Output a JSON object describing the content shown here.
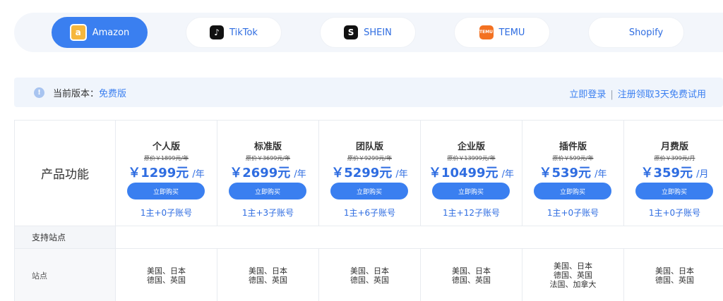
{
  "platforms": [
    {
      "label": "Amazon",
      "icon": "amazon-icon",
      "glyph": "a",
      "active": true
    },
    {
      "label": "TikTok",
      "icon": "tiktok-icon",
      "glyph": "♪",
      "active": false
    },
    {
      "label": "SHEIN",
      "icon": "shein-icon",
      "glyph": "S",
      "active": false
    },
    {
      "label": "TEMU",
      "icon": "temu-icon",
      "glyph": "TEMU",
      "active": false
    },
    {
      "label": "Shopify",
      "icon": "shopify-icon",
      "glyph": "🛍",
      "active": false
    }
  ],
  "version": {
    "label": "当前版本：",
    "value": "免费版",
    "login_link": "立即登录",
    "separator": "|",
    "trial_link": "注册领取3天免费试用"
  },
  "table": {
    "feature_header": "产品功能",
    "plans": [
      {
        "name": "个人版",
        "original": "原价￥1899元/年",
        "price": "￥1299元",
        "unit": "/年",
        "button": "立即购买",
        "accounts": "1主+0子账号",
        "sites": [
          "美国、日本",
          "德国、英国"
        ]
      },
      {
        "name": "标准版",
        "original": "原价￥3699元/年",
        "price": "￥2699元",
        "unit": "/年",
        "button": "立即购买",
        "accounts": "1主+3子账号",
        "sites": [
          "美国、日本",
          "德国、英国"
        ]
      },
      {
        "name": "团队版",
        "original": "原价￥9299元/年",
        "price": "￥5299元",
        "unit": "/年",
        "button": "立即购买",
        "accounts": "1主+6子账号",
        "sites": [
          "美国、日本",
          "德国、英国"
        ]
      },
      {
        "name": "企业版",
        "original": "原价￥13999元/年",
        "price": "￥10499元",
        "unit": "/年",
        "button": "立即购买",
        "accounts": "1主+12子账号",
        "sites": [
          "美国、日本",
          "德国、英国"
        ]
      },
      {
        "name": "插件版",
        "original": "原价￥599元/年",
        "price": "￥539元",
        "unit": "/年",
        "button": "立即购买",
        "accounts": "1主+0子账号",
        "sites": [
          "美国、日本",
          "德国、英国",
          "法国、加拿大"
        ]
      },
      {
        "name": "月费版",
        "original": "原价￥399元/月",
        "price": "￥359元",
        "unit": "/月",
        "button": "立即购买",
        "accounts": "1主+0子账号",
        "sites": [
          "美国、日本",
          "德国、英国"
        ]
      }
    ],
    "section_label": "支持站点",
    "sites_label": "站点"
  },
  "colors": {
    "accent": "#3a7ff0",
    "price": "#2f6de1"
  }
}
